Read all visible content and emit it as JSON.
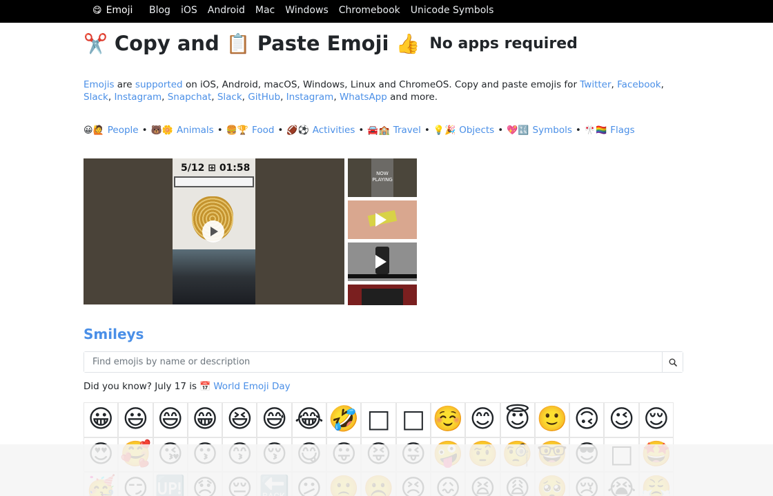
{
  "nav": {
    "brand_icon": "😋",
    "brand_label": "Emoji",
    "links": [
      "Blog",
      "iOS",
      "Android",
      "Mac",
      "Windows",
      "Chromebook",
      "Unicode Symbols"
    ]
  },
  "heading": {
    "scissors_icon": "✂️",
    "copy_label": "Copy and",
    "clipboard_icon": "📋",
    "paste_label": "Paste Emoji",
    "thumbs_icon": "👍",
    "tagline": "No apps required"
  },
  "intro": {
    "emojis": "Emojis",
    "are": "are",
    "supported": "supported",
    "on_platforms": "on iOS, Android, macOS, Windows, Linux and ChromeOS. Copy and paste emojis for",
    "twitter": "Twitter",
    "facebook": "Facebook",
    "slack": "Slack",
    "instagram": "Instagram",
    "snapchat": "Snapchat",
    "slack2": "Slack",
    "github": "GitHub",
    "instagram2": "Instagram",
    "whatsapp": "WhatsApp",
    "and_more": "and more."
  },
  "categories": [
    {
      "icons": "😀🙋",
      "label": "People"
    },
    {
      "icons": "🐻🌼",
      "label": "Animals"
    },
    {
      "icons": "🍔🏆",
      "label": "Food"
    },
    {
      "icons": "🏈⚽",
      "label": "Activities"
    },
    {
      "icons": "🚘🏫",
      "label": "Travel"
    },
    {
      "icons": "💡🎉",
      "label": "Objects"
    },
    {
      "icons": "💖🔣",
      "label": "Symbols"
    },
    {
      "icons": "🎌🏳️‍🌈",
      "label": "Flags"
    }
  ],
  "video": {
    "time_text": "5/12 ⊞ 01:58",
    "now_playing": "NOW PLAYING"
  },
  "smileys": {
    "title": "Smileys",
    "search_placeholder": "Find emojis by name or description",
    "did_you_know": "Did you know? July 17 is",
    "calendar_icon": "📅",
    "world_emoji_day": "World Emoji Day",
    "emojis": [
      "😀",
      "😃",
      "😄",
      "😁",
      "😆",
      "😅",
      "😂",
      "🤣",
      "□",
      "□",
      "☺️",
      "😊",
      "😇",
      "🙂",
      "🙃",
      "😉",
      "😌",
      "😍",
      "🥰",
      "😘",
      "😗",
      "😙",
      "😚",
      "😋",
      "😛",
      "😝",
      "😜",
      "🤪",
      "🤨",
      "🧐",
      "🤓",
      "😎",
      "□",
      "🤩",
      "🥳",
      "😏",
      "🆙",
      "😞",
      "😔",
      "🔙",
      "😕",
      "🙁",
      "☹️",
      "😣",
      "😖",
      "😫",
      "😩",
      "🥺",
      "😢",
      "😭",
      "😤"
    ]
  }
}
